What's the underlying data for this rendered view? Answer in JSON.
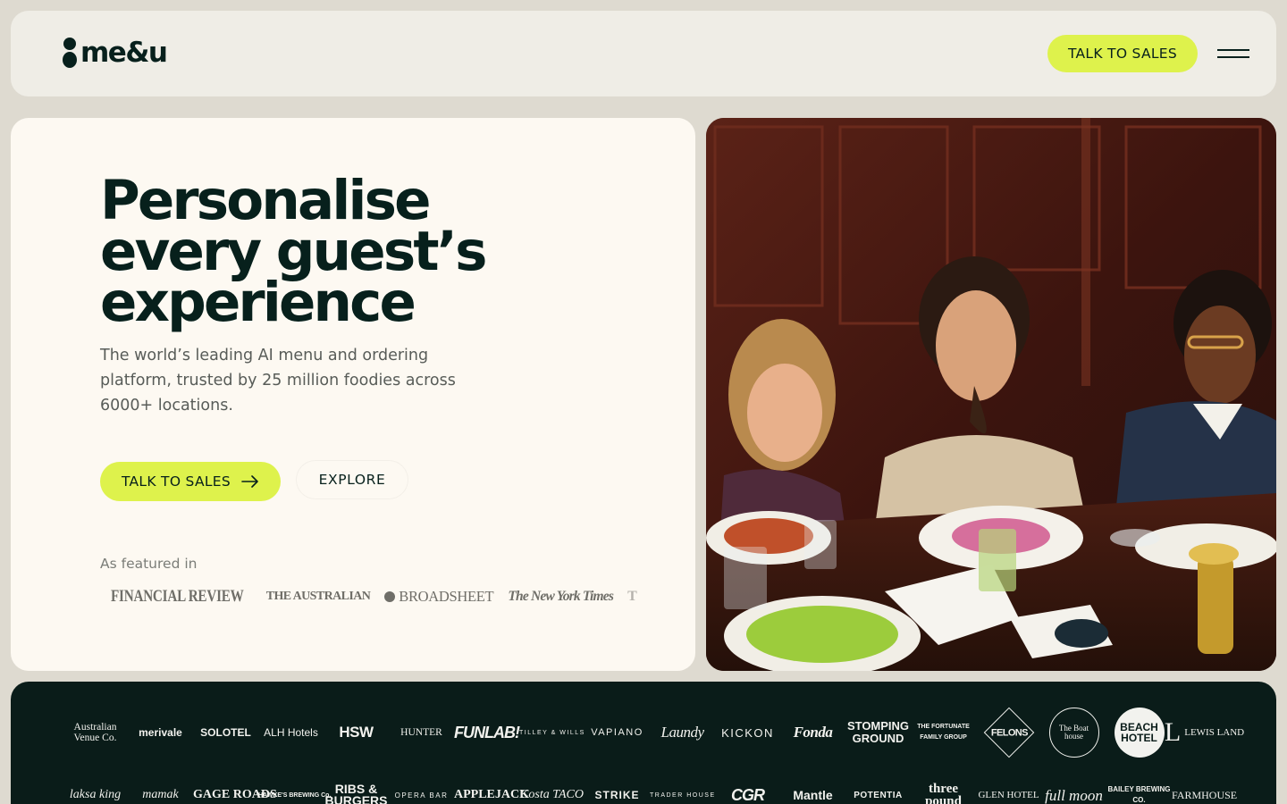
{
  "header": {
    "logo_text": "me&u",
    "cta_label": "TALK TO SALES"
  },
  "hero": {
    "headline": [
      "Personalise",
      "every guest’s",
      "experience"
    ],
    "subtext": "The world’s leading AI menu and ordering platform, trusted by 25 million foodies across 6000+ locations.",
    "primary_cta": "TALK TO SALES",
    "secondary_cta": "EXPLORE",
    "featured_label": "As featured in",
    "press": [
      "FINANCIAL REVIEW",
      "THE AUSTRALIAN",
      "BROADSHEET",
      "The New York Times",
      "T"
    ]
  },
  "clients": {
    "row1": [
      "Australian Venue Co.",
      "merivale",
      "SOLOTEL",
      "ALH Hotels",
      "HSW",
      "HUNTER",
      "FUNLAB!",
      "TILLEY & WILLS",
      "VAPIANO",
      "Laundy",
      "KICKON",
      "Fonda",
      "STOMPING GROUND",
      "THE FORTUNATE FAMILY GROUP",
      "FELONS",
      "The Boat house",
      "BEACH HOTEL",
      "LEWIS LAND"
    ],
    "row2": [
      "laksa king",
      "mamak",
      "GAGE ROADS",
      "HAWKE'S BREWING Co.",
      "RIBS & BURGERS",
      "OPERA BAR",
      "APPLEJACK",
      "Costa TACO",
      "STRIKE",
      "TRADER HOUSE",
      "CGR",
      "Mantle",
      "POTENTIA",
      "three pound",
      "GLEN HOTEL",
      "full moon",
      "BAILEY BREWING CO.",
      "FARMHOUSE"
    ]
  },
  "colors": {
    "accent": "#def24c",
    "dark": "#07201c",
    "cream": "#fdf9f2",
    "page_bg": "#dedad0"
  }
}
